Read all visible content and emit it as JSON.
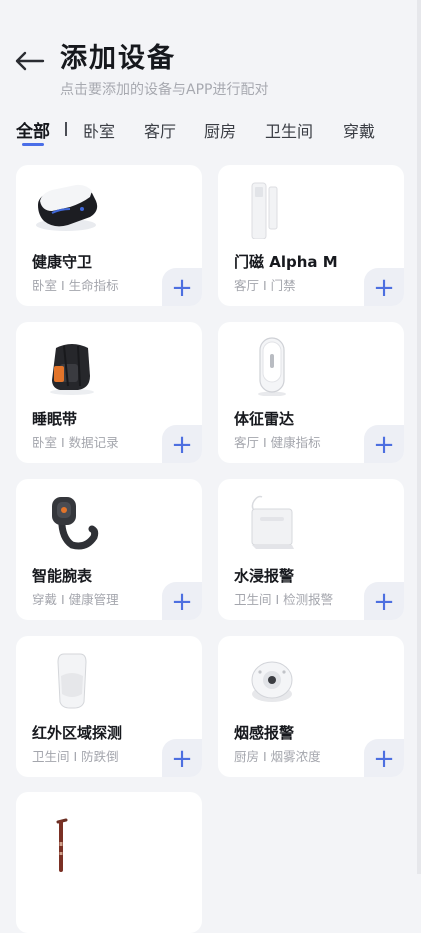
{
  "header": {
    "title": "添加设备",
    "subtitle": "点击要添加的设备与APP进行配对"
  },
  "tabs": [
    {
      "label": "全部",
      "active": true
    },
    {
      "label": "卧室",
      "active": false
    },
    {
      "label": "客厅",
      "active": false
    },
    {
      "label": "厨房",
      "active": false
    },
    {
      "label": "卫生间",
      "active": false
    },
    {
      "label": "穿戴",
      "active": false
    }
  ],
  "devices": [
    {
      "name": "健康守卫",
      "desc": "卧室 I 生命指标",
      "icon": "health-guard-device-icon"
    },
    {
      "name": "门磁 Alpha M",
      "desc": "客厅 I 门禁",
      "icon": "door-sensor-icon"
    },
    {
      "name": "睡眠带",
      "desc": "卧室 I 数据记录",
      "icon": "sleep-belt-icon"
    },
    {
      "name": "体征雷达",
      "desc": "客厅 I 健康指标",
      "icon": "vital-radar-icon"
    },
    {
      "name": "智能腕表",
      "desc": "穿戴 I 健康管理",
      "icon": "smart-watch-icon"
    },
    {
      "name": "水浸报警",
      "desc": "卫生间 I 检测报警",
      "icon": "water-leak-sensor-icon"
    },
    {
      "name": "红外区域探测",
      "desc": "卫生间 I 防跌倒",
      "icon": "infrared-detector-icon"
    },
    {
      "name": "烟感报警",
      "desc": "厨房 I 烟雾浓度",
      "icon": "smoke-alarm-icon"
    },
    {
      "name": "",
      "desc": "",
      "icon": "walking-cane-icon"
    }
  ],
  "add_symbol": "+",
  "colors": {
    "accent": "#4a6ee8",
    "background": "#f3f4f7",
    "card": "#ffffff",
    "add_button_bg": "#edeff5"
  }
}
